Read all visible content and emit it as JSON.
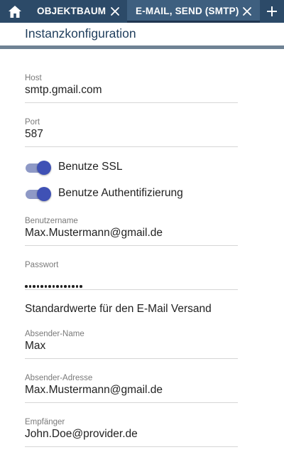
{
  "tabs": [
    {
      "label": "OBJEKTBAUM",
      "active": false
    },
    {
      "label": "E-MAIL, SEND (SMTP)",
      "active": true
    }
  ],
  "icons": {
    "home": "home-icon",
    "close": "close-icon",
    "add": "plus-icon"
  },
  "colors": {
    "tabbar_bg": "#2c4a68",
    "active_tab_bg": "#3e5f7f",
    "accent": "#3f51b5",
    "title_text": "#1e3d5c"
  },
  "panel": {
    "title": "Instanzkonfiguration"
  },
  "form": {
    "host": {
      "label": "Host",
      "value": "smtp.gmail.com"
    },
    "port": {
      "label": "Port",
      "value": "587"
    },
    "ssl_toggle": {
      "label": "Benutze SSL",
      "checked": true
    },
    "auth_toggle": {
      "label": "Benutze Authentifizierung",
      "checked": true
    },
    "username": {
      "label": "Benutzername",
      "value": "Max.Mustermann@gmail.de"
    },
    "password": {
      "label": "Passwort",
      "masked_length": 15
    },
    "defaults_heading": "Standardwerte für den E-Mail Versand",
    "sender_name": {
      "label": "Absender-Name",
      "value": "Max"
    },
    "sender_address": {
      "label": "Absender-Adresse",
      "value": "Max.Mustermann@gmail.de"
    },
    "recipient": {
      "label": "Empfänger",
      "value": "John.Doe@provider.de"
    }
  }
}
